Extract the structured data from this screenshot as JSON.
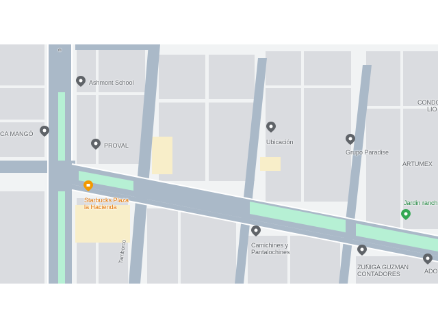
{
  "places": {
    "ashmont": "Ashmont School",
    "mango": "CA MANGÓ",
    "proval": "PROVAL",
    "ubicacion": "Ubicación",
    "grupo_paradise": "Grupo Paradise",
    "condo_line1": "CONDO",
    "condo_line2": "LIO",
    "artumex": "ARTUMEX",
    "jardin": "Jardin ranch",
    "starbucks_line1": "Starbucks Plaza",
    "starbucks_line2": "la Hacienda",
    "camichines_line1": "Camichines y",
    "camichines_line2": "Pantalochines",
    "zuniga_line1": "ZUÑIGA GUZMAN",
    "zuniga_line2": "CONTADORES",
    "ado": "ADO"
  },
  "streets": {
    "tamborco": "Tamborco",
    "top_left_fragment": "e"
  },
  "colors": {
    "background": "#f1f3f4",
    "road": "#aab9c8",
    "median": "#b6f0d4",
    "block": "#dadce0",
    "highlight": "#f8eec9",
    "pin_gray": "#5f6368",
    "pin_orange": "#f29900",
    "pin_green": "#34a853"
  }
}
